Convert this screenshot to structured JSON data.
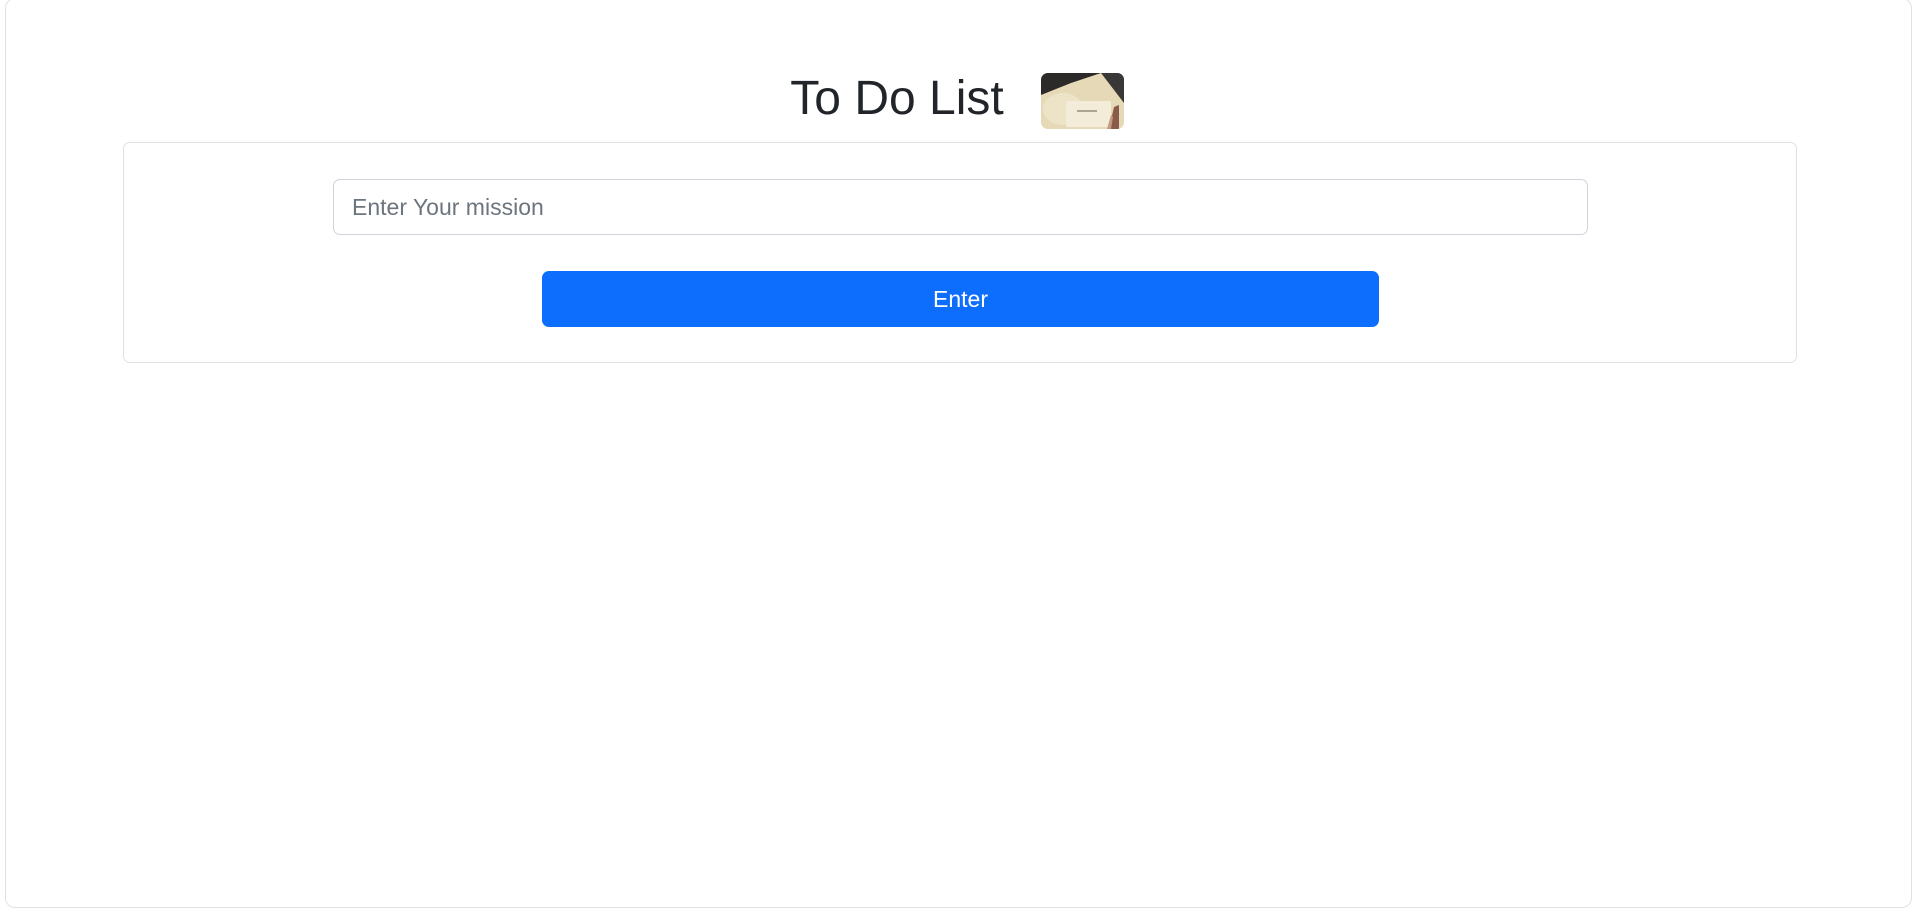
{
  "header": {
    "title": "To Do List",
    "logo_icon": "notebook-photo-icon"
  },
  "form": {
    "mission_placeholder": "Enter Your mission",
    "mission_value": "",
    "enter_label": "Enter"
  },
  "colors": {
    "primary": "#0d6efd",
    "text": "#212529",
    "border": "#dee2e6"
  }
}
